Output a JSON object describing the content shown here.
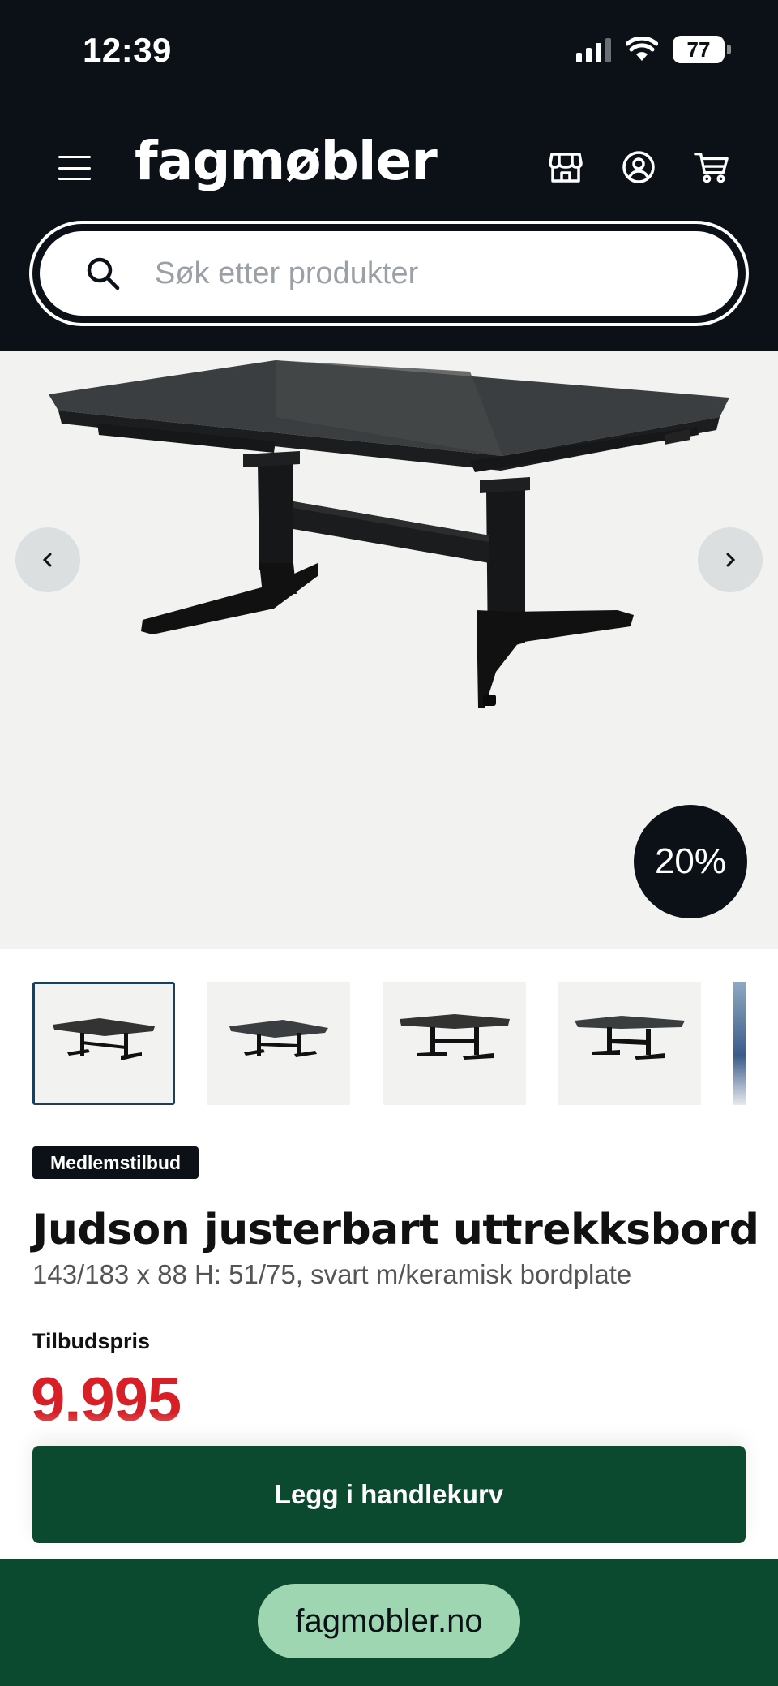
{
  "status_bar": {
    "time": "12:39",
    "battery": "77",
    "icons": [
      "signal-icon",
      "wifi-icon",
      "battery-icon"
    ]
  },
  "header": {
    "logo": "fagmøbler",
    "icons": [
      "menu-icon",
      "store-icon",
      "account-icon",
      "cart-icon"
    ]
  },
  "search": {
    "placeholder": "Søk etter produkter"
  },
  "gallery": {
    "discount_badge": "20%",
    "thumbnail_count_visible": 5,
    "active_thumbnail": 1
  },
  "product": {
    "badge": "Medlemstilbud",
    "title": "Judson justerbart uttrekksbord",
    "subtitle": "143/183 x 88 H: 51/75, svart m/keramisk bordplate",
    "price_label": "Tilbudspris",
    "price": "9.995"
  },
  "actions": {
    "add_to_cart": "Legg i handlekurv"
  },
  "browser": {
    "url": "fagmobler.no"
  },
  "colors": {
    "header_bg": "#0b1116",
    "price_red": "#d61f26",
    "cart_green": "#0c4a2f",
    "url_pill": "#9fd6b2"
  }
}
